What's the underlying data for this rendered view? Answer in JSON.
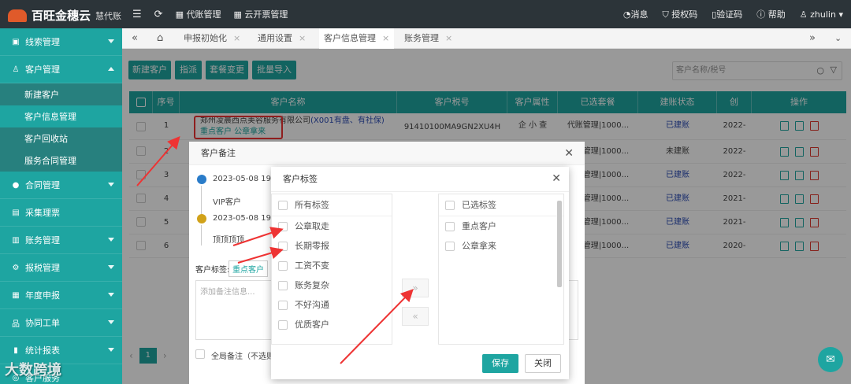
{
  "brand": {
    "name": "百旺金穗云",
    "sub": "慧代账"
  },
  "topmenu": {
    "agency": "代账管理",
    "invoice": "云开票管理"
  },
  "topright": {
    "msg": "消息",
    "auth": "授权码",
    "verify": "验证码",
    "help": "帮助",
    "user": "zhulin"
  },
  "sidebar": {
    "items": [
      {
        "label": "线索管理"
      },
      {
        "label": "客户管理"
      }
    ],
    "subitems": [
      {
        "label": "新建客户"
      },
      {
        "label": "客户信息管理"
      },
      {
        "label": "客户回收站"
      },
      {
        "label": "服务合同管理"
      }
    ],
    "items2": [
      {
        "label": "合同管理"
      },
      {
        "label": "采集理票"
      },
      {
        "label": "账务管理"
      },
      {
        "label": "报税管理"
      },
      {
        "label": "年度申报"
      },
      {
        "label": "协同工单"
      },
      {
        "label": "统计报表"
      },
      {
        "label": "客户服务"
      }
    ]
  },
  "tabs": [
    {
      "label": "申报初始化"
    },
    {
      "label": "通用设置"
    },
    {
      "label": "客户信息管理"
    },
    {
      "label": "账务管理"
    }
  ],
  "toolbar": {
    "new": "新建客户",
    "assign": "指派",
    "plan": "套餐变更",
    "import": "批量导入",
    "search_placeholder": "客户名称/税号"
  },
  "table": {
    "headers": [
      "序号",
      "客户名称",
      "客户税号",
      "客户属性",
      "已选套餐",
      "建账状态",
      "创",
      "操作"
    ],
    "rows": [
      {
        "no": "1",
        "name": "郑州凌晨西点美容服务有限公司",
        "name_extra": "(X001有盘、有社保)",
        "tags": "重点客户  公章拿来",
        "tax": "91410100MA9GN2XU4H",
        "attr": "企 小 查",
        "plan": "代账管理|1000...",
        "status": "已建账",
        "date": "2022-"
      },
      {
        "no": "2",
        "plan": "代账管理|1000...",
        "status": "未建账",
        "date": "2022-"
      },
      {
        "no": "3",
        "plan": "代账管理|1000...",
        "status": "已建账",
        "date": "2022-"
      },
      {
        "no": "4",
        "plan": "代账管理|1000...",
        "status": "已建账",
        "date": "2021-"
      },
      {
        "no": "5",
        "plan": "代账管理|1000...",
        "status": "已建账",
        "date": "2021-"
      },
      {
        "no": "6",
        "plan": "代账管理|1000...",
        "status": "已建账",
        "date": "2020-"
      }
    ]
  },
  "pager": {
    "page": "1"
  },
  "remark_modal": {
    "title": "客户备注",
    "entries": [
      {
        "time": "2023-05-08 19:1",
        "text": "VIP客户"
      },
      {
        "time": "2023-05-08 19:1",
        "text": "顶顶顶顶"
      }
    ],
    "tag_label": "客户标签:",
    "tag_value": "重点客户",
    "placeholder": "添加备注信息...",
    "global": "全局备注（不选则"
  },
  "tag_modal": {
    "title": "客户标签",
    "left_head": "所有标签",
    "left_items": [
      "公章取走",
      "长期零报",
      "工资不变",
      "账务复杂",
      "不好沟通",
      "优质客户"
    ],
    "right_head": "已选标签",
    "right_items": [
      "重点客户",
      "公章拿来"
    ],
    "save": "保存",
    "close": "关闭"
  },
  "watermark": "大数跨境"
}
